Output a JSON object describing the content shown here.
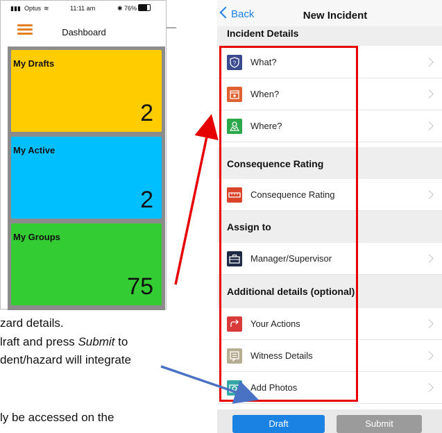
{
  "document_text": {
    "line1": "zard details.",
    "line2_prefix": "lraft and press ",
    "line2_em": "Submit",
    "line2_suffix": " to",
    "line3": "dent/hazard will integrate",
    "line4": "ly be accessed on the"
  },
  "left_phone": {
    "status": {
      "carrier": "Optus",
      "time": "11:11 am",
      "battery": "76%"
    },
    "title": "Dashboard",
    "tiles": [
      {
        "label": "My Drafts",
        "count": "2",
        "color": "#ffcc00"
      },
      {
        "label": "My Active",
        "count": "2",
        "color": "#00bfff"
      },
      {
        "label": "My Groups",
        "count": "75",
        "color": "#33cc33"
      }
    ]
  },
  "right_phone": {
    "back_label": "Back",
    "title": "New Incident",
    "sections": [
      {
        "header": "Incident Details",
        "rows": [
          {
            "label": "What?",
            "icon": "shield-question-icon",
            "color": "#3b4a8f"
          },
          {
            "label": "When?",
            "icon": "calendar-icon",
            "color": "#e06030"
          },
          {
            "label": "Where?",
            "icon": "map-icon",
            "color": "#2aa84a"
          }
        ]
      },
      {
        "header": "Consequence Rating",
        "rows": [
          {
            "label": "Consequence Rating",
            "icon": "ruler-icon",
            "color": "#d9442b"
          }
        ]
      },
      {
        "header": "Assign to",
        "rows": [
          {
            "label": "Manager/Supervisor",
            "icon": "briefcase-icon",
            "color": "#1f2a44"
          }
        ]
      },
      {
        "header": "Additional details (optional)",
        "rows": [
          {
            "label": "Your Actions",
            "icon": "redo-arrow-icon",
            "color": "#d93a3a"
          },
          {
            "label": "Witness Details",
            "icon": "chat-bubble-icon",
            "color": "#b7ad92"
          },
          {
            "label": "Add Photos",
            "icon": "camera-icon",
            "color": "#36a7a7"
          }
        ]
      }
    ],
    "buttons": {
      "draft": "Draft",
      "submit": "Submit"
    },
    "colors": {
      "draft": "#1a82e2",
      "submit": "#9b9b9b",
      "highlight": "#e60000",
      "arrow_blue": "#4a72c4"
    }
  }
}
